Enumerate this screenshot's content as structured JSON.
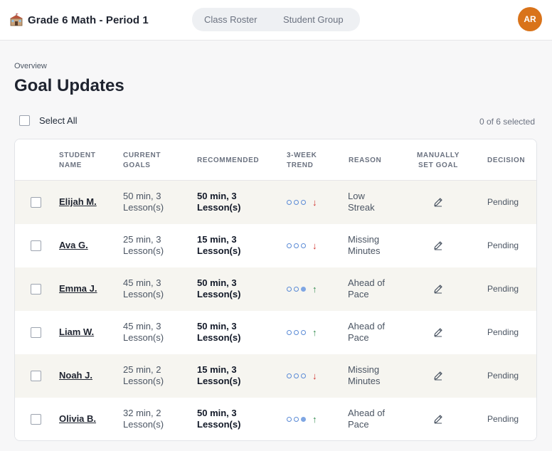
{
  "header": {
    "title": "Grade 6 Math - Period 1",
    "tabs": [
      {
        "label": "Class Roster"
      },
      {
        "label": "Student Group"
      }
    ],
    "avatar_initials": "AR",
    "avatar_color": "#d9731a"
  },
  "page": {
    "eyebrow": "Overview",
    "title": "Goal Updates",
    "select_all_label": "Select All",
    "selected_count": "0 of 6 selected"
  },
  "table": {
    "columns": {
      "student_name": [
        "Student",
        "Name"
      ],
      "current_goals": [
        "Current",
        "Goals"
      ],
      "recommended": "Recommended",
      "trend": [
        "3-Week",
        "Trend"
      ],
      "reason": "Reason",
      "manual": [
        "Manually",
        "Set Goal"
      ],
      "decision": "Decision"
    },
    "rows": [
      {
        "name": "Elijah M.",
        "current": [
          "50 min, 3",
          "Lesson(s)"
        ],
        "recommended": [
          "50 min, 3",
          "Lesson(s)"
        ],
        "trend_dots": [
          0,
          0,
          0
        ],
        "trend_dir": "down",
        "reason": [
          "Low",
          "Streak"
        ],
        "decision": "Pending"
      },
      {
        "name": "Ava G.",
        "current": [
          "25 min, 3",
          "Lesson(s)"
        ],
        "recommended": [
          "15 min, 3",
          "Lesson(s)"
        ],
        "trend_dots": [
          0,
          0,
          0
        ],
        "trend_dir": "down",
        "reason": [
          "Missing",
          "Minutes"
        ],
        "decision": "Pending"
      },
      {
        "name": "Emma J.",
        "current": [
          "45 min, 3",
          "Lesson(s)"
        ],
        "recommended": [
          "50 min, 3",
          "Lesson(s)"
        ],
        "trend_dots": [
          0,
          0,
          1
        ],
        "trend_dir": "up",
        "reason": [
          "Ahead of",
          "Pace"
        ],
        "decision": "Pending"
      },
      {
        "name": "Liam W.",
        "current": [
          "45 min, 3",
          "Lesson(s)"
        ],
        "recommended": [
          "50 min, 3",
          "Lesson(s)"
        ],
        "trend_dots": [
          0,
          0,
          0
        ],
        "trend_dir": "up",
        "reason": [
          "Ahead of",
          "Pace"
        ],
        "decision": "Pending"
      },
      {
        "name": "Noah J.",
        "current": [
          "25 min, 2",
          "Lesson(s)"
        ],
        "recommended": [
          "15 min, 3",
          "Lesson(s)"
        ],
        "trend_dots": [
          0,
          0,
          0
        ],
        "trend_dir": "down",
        "reason": [
          "Missing",
          "Minutes"
        ],
        "decision": "Pending"
      },
      {
        "name": "Olivia B.",
        "current": [
          "32 min, 2",
          "Lesson(s)"
        ],
        "recommended": [
          "50 min, 3",
          "Lesson(s)"
        ],
        "trend_dots": [
          0,
          0,
          1
        ],
        "trend_dir": "up",
        "reason": [
          "Ahead of",
          "Pace"
        ],
        "decision": "Pending"
      }
    ]
  },
  "icons": {
    "brand": "school-building-icon",
    "row_edit": "pencil-icon",
    "trend_up": "arrow-up-icon",
    "trend_down": "arrow-down-icon"
  },
  "colors": {
    "trend_up": "#2f8a4c",
    "trend_down": "#d0322d",
    "trend_dot": "#5b8bd6",
    "row_alt": "#f6f5f0"
  }
}
